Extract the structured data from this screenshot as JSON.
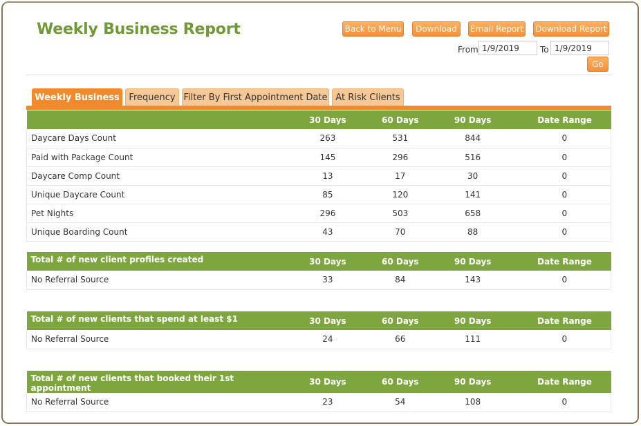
{
  "header": {
    "title": "Weekly Business Report",
    "buttons": {
      "back": "Back to Menu",
      "download": "Download",
      "email": "Email Report",
      "download_report": "Download Report"
    },
    "range": {
      "from_label": "From",
      "from_value": "1/9/2019",
      "to_label": "To",
      "to_value": "1/9/2019",
      "go": "Go"
    }
  },
  "tabs": [
    "Weekly Business",
    "Frequency",
    "Filter By First Appointment Date",
    "At Risk Clients"
  ],
  "columns": [
    "30 Days",
    "60 Days",
    "90 Days",
    "Date Range"
  ],
  "weekly": {
    "title": "",
    "rows": [
      {
        "label": "Daycare Days Count",
        "values": [
          "263",
          "531",
          "844",
          "0"
        ]
      },
      {
        "label": "Paid with Package Count",
        "values": [
          "145",
          "296",
          "516",
          "0"
        ]
      },
      {
        "label": "Daycare Comp Count",
        "values": [
          "13",
          "17",
          "30",
          "0"
        ]
      },
      {
        "label": "Unique Daycare Count",
        "values": [
          "85",
          "120",
          "141",
          "0"
        ]
      },
      {
        "label": "Pet Nights",
        "values": [
          "296",
          "503",
          "658",
          "0"
        ]
      },
      {
        "label": "Unique Boarding Count",
        "values": [
          "43",
          "70",
          "88",
          "0"
        ]
      }
    ]
  },
  "new_profiles": {
    "title": "Total # of new client profiles created",
    "rows": [
      {
        "label": "No Referral Source",
        "values": [
          "33",
          "84",
          "143",
          "0"
        ]
      }
    ]
  },
  "spend_clients": {
    "title": "Total # of new clients that spend at least $1",
    "rows": [
      {
        "label": "No Referral Source",
        "values": [
          "24",
          "66",
          "111",
          "0"
        ]
      }
    ]
  },
  "booked_clients": {
    "title": "Total # of new clients that booked their 1st appointment",
    "rows": [
      {
        "label": "No Referral Source",
        "values": [
          "23",
          "54",
          "108",
          "0"
        ]
      }
    ]
  }
}
